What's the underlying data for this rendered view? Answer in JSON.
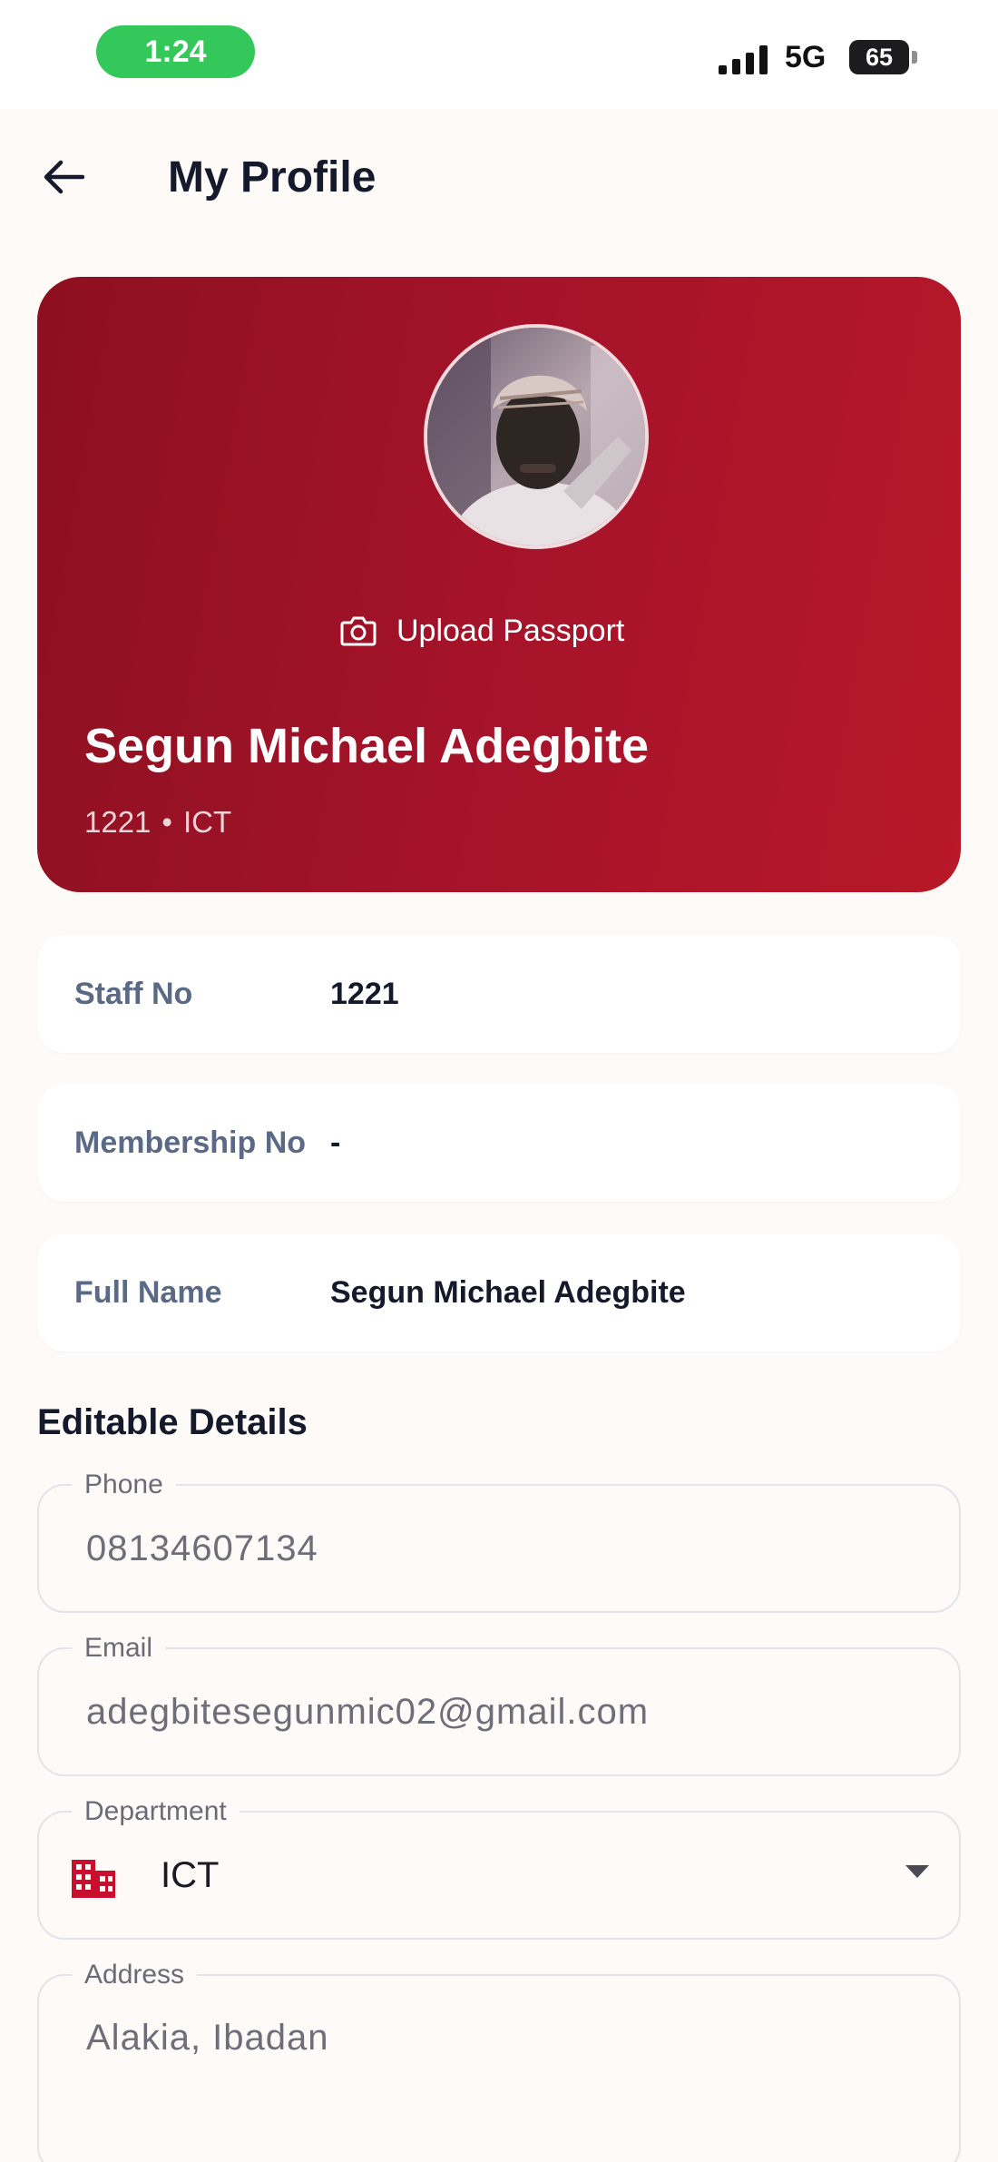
{
  "status_bar": {
    "time": "1:24",
    "network": "5G",
    "battery": "65"
  },
  "header": {
    "title": "My Profile",
    "back_icon": "arrow-left-icon"
  },
  "profile_card": {
    "upload_label": "Upload Passport",
    "upload_icon": "camera-icon",
    "name": "Segun Michael Adegbite",
    "staff_no": "1221",
    "separator": "•",
    "department": "ICT",
    "gradient": [
      "#8d1020",
      "#b81828"
    ]
  },
  "info_rows": [
    {
      "label": "Staff No",
      "value": "1221"
    },
    {
      "label": "Membership No",
      "value": "-"
    },
    {
      "label": "Full Name",
      "value": "Segun Michael Adegbite"
    }
  ],
  "editable": {
    "section_title": "Editable Details",
    "phone": {
      "label": "Phone",
      "value": "08134607134"
    },
    "email": {
      "label": "Email",
      "value": "adegbitesegunmic02@gmail.com"
    },
    "department": {
      "label": "Department",
      "value": "ICT",
      "icon": "building-icon",
      "icon_color": "#c8102e"
    },
    "address": {
      "label": "Address",
      "value": "Alakia, Ibadan"
    }
  }
}
